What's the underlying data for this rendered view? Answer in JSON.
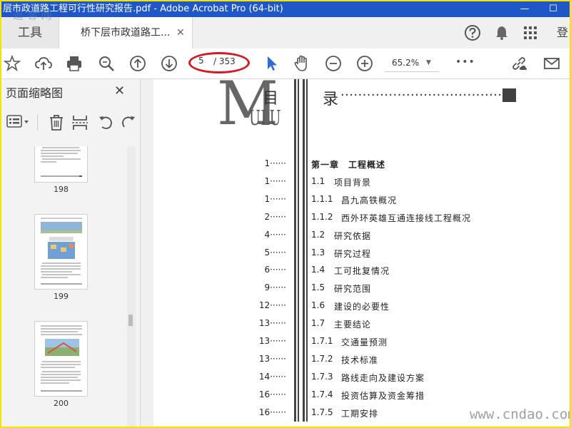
{
  "window": {
    "title": "层市政道路工程可行性研究报告.pdf - Adobe Acrobat Pro (64-bit)",
    "minimize": "—",
    "maximize": "☐"
  },
  "tabs": {
    "tools_label": "工具",
    "document_label": "桥下层市政道路工...",
    "close_glyph": "✕",
    "login_label": "登"
  },
  "toolbar": {
    "current_page": "5",
    "total_pages": "/ 353",
    "zoom": "65.2%",
    "more": "•••",
    "annotation_color": "#d71920"
  },
  "thumbnail_panel": {
    "title": "页面缩略图",
    "close_glyph": "✕",
    "pages": [
      {
        "label": "198"
      },
      {
        "label": "199"
      },
      {
        "label": "200"
      }
    ]
  },
  "document": {
    "header": {
      "m_letter": "M",
      "mu_char": "目",
      "ulu_letters": "ULU",
      "lu_char": "录",
      "lu_dots": "······································"
    },
    "toc": [
      {
        "page": "1······",
        "num": "",
        "title": "第一章　工程概述",
        "bold": true
      },
      {
        "page": "1······",
        "num": "1.1",
        "title": "项目背景"
      },
      {
        "page": "1······",
        "num": "1.1.1",
        "title": "昌九高铁概况"
      },
      {
        "page": "2······",
        "num": "1.1.2",
        "title": "西外环英雄互通连接线工程概况"
      },
      {
        "page": "4······",
        "num": "1.2",
        "title": "研究依据"
      },
      {
        "page": "5······",
        "num": "1.3",
        "title": "研究过程"
      },
      {
        "page": "6······",
        "num": "1.4",
        "title": "工可批复情况"
      },
      {
        "page": "9······",
        "num": "1.5",
        "title": "研究范围"
      },
      {
        "page": "12······",
        "num": "1.6",
        "title": "建设的必要性"
      },
      {
        "page": "13······",
        "num": "1.7",
        "title": "主要结论"
      },
      {
        "page": "13······",
        "num": "1.7.1",
        "title": "交通量预测"
      },
      {
        "page": "13······",
        "num": "1.7.2",
        "title": "技术标准"
      },
      {
        "page": "14······",
        "num": "1.7.3",
        "title": "路线走向及建设方案"
      },
      {
        "page": "16······",
        "num": "1.7.4",
        "title": "投资估算及资金筹措"
      },
      {
        "page": "16······",
        "num": "1.7.5",
        "title": "工期安排"
      }
    ]
  },
  "watermarks": {
    "top_left": "道 客 网",
    "bottom_right": "www.cndao.com"
  }
}
